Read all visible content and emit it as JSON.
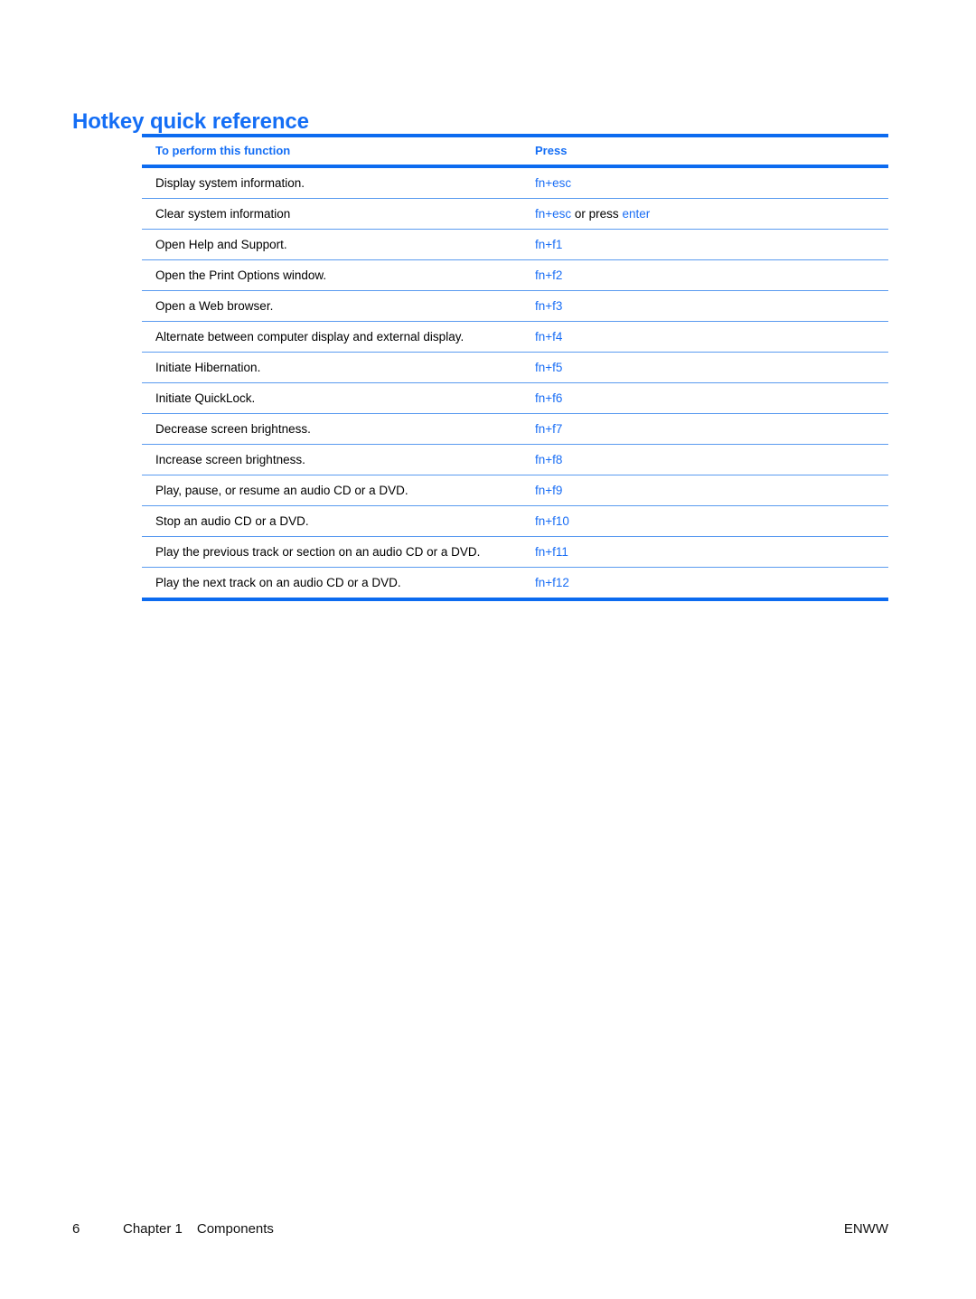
{
  "document": {
    "heading": "Hotkey quick reference"
  },
  "table": {
    "columns": [
      {
        "key": "function",
        "label": "To perform this function"
      },
      {
        "key": "press",
        "label": "Press"
      }
    ],
    "rows": [
      {
        "function": "Display system information.",
        "press": "fn+esc",
        "press_suffix_plain": "",
        "press_suffix_key": ""
      },
      {
        "function": "Clear system information",
        "press": "fn+esc",
        "press_suffix_plain": " or press ",
        "press_suffix_key": "enter"
      },
      {
        "function": "Open Help and Support.",
        "press": "fn+f1",
        "press_suffix_plain": "",
        "press_suffix_key": ""
      },
      {
        "function": "Open the Print Options window.",
        "press": "fn+f2",
        "press_suffix_plain": "",
        "press_suffix_key": ""
      },
      {
        "function": "Open a Web browser.",
        "press": "fn+f3",
        "press_suffix_plain": "",
        "press_suffix_key": ""
      },
      {
        "function": "Alternate between computer display and external display.",
        "press": "fn+f4",
        "press_suffix_plain": "",
        "press_suffix_key": ""
      },
      {
        "function": "Initiate Hibernation.",
        "press": "fn+f5",
        "press_suffix_plain": "",
        "press_suffix_key": ""
      },
      {
        "function": "Initiate QuickLock.",
        "press": "fn+f6",
        "press_suffix_plain": "",
        "press_suffix_key": ""
      },
      {
        "function": "Decrease screen brightness.",
        "press": "fn+f7",
        "press_suffix_plain": "",
        "press_suffix_key": ""
      },
      {
        "function": "Increase screen brightness.",
        "press": "fn+f8",
        "press_suffix_plain": "",
        "press_suffix_key": ""
      },
      {
        "function": "Play, pause, or resume an audio CD or a DVD.",
        "press": "fn+f9",
        "press_suffix_plain": "",
        "press_suffix_key": ""
      },
      {
        "function": "Stop an audio CD or a DVD.",
        "press": "fn+f10",
        "press_suffix_plain": "",
        "press_suffix_key": ""
      },
      {
        "function": "Play the previous track or section on an audio CD or a DVD.",
        "press": "fn+f11",
        "press_suffix_plain": "",
        "press_suffix_key": ""
      },
      {
        "function": "Play the next track on an audio CD or a DVD.",
        "press": "fn+f12",
        "press_suffix_plain": "",
        "press_suffix_key": ""
      }
    ]
  },
  "footer": {
    "page_number": "6",
    "chapter": "Chapter 1",
    "section": "Components",
    "locale": "ENWW"
  },
  "colors": {
    "accent_blue": "#146ef5",
    "rule_blue": "#0c6bf0",
    "row_rule_blue": "#5a9bf0",
    "body_text": "#000000"
  }
}
